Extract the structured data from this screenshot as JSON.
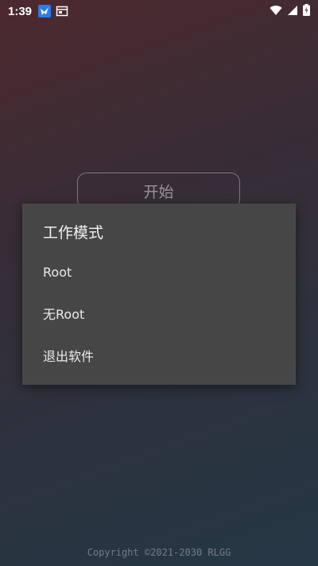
{
  "status_bar": {
    "time": "1:39",
    "app_icon": "bird-app-icon",
    "notification_icon": "window-icon",
    "wifi_icon": "wifi-icon",
    "signal_icon": "signal-icon",
    "battery_icon": "battery-charging-icon"
  },
  "main": {
    "start_label": "开始",
    "copyright": "Copyright ©2021-2030 RLGG"
  },
  "dialog": {
    "title": "工作模式",
    "items": [
      {
        "label": "Root"
      },
      {
        "label": "无Root"
      },
      {
        "label": "退出软件"
      }
    ]
  }
}
